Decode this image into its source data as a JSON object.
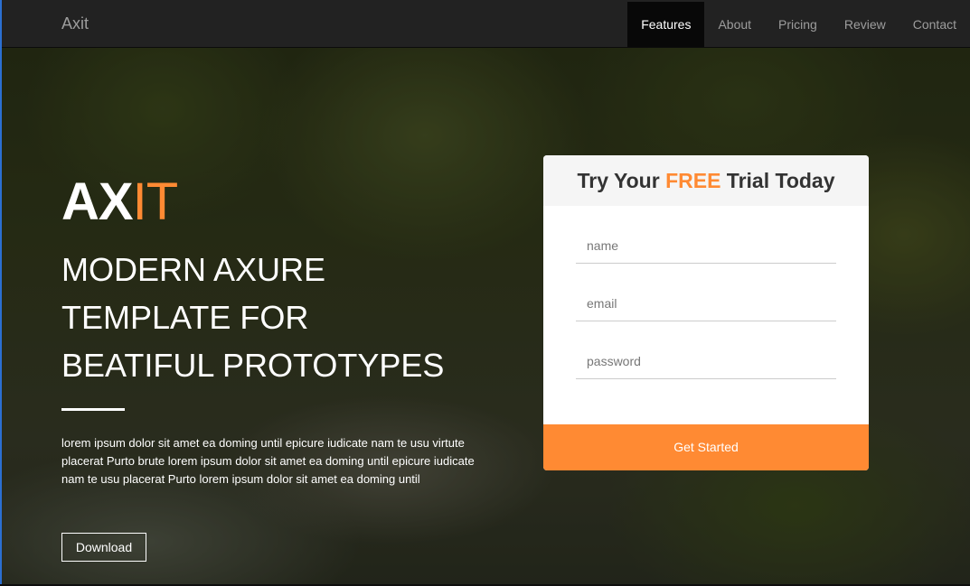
{
  "navbar": {
    "brand": "Axit",
    "items": [
      {
        "label": "Features",
        "active": true
      },
      {
        "label": "About",
        "active": false
      },
      {
        "label": "Pricing",
        "active": false
      },
      {
        "label": "Review",
        "active": false
      },
      {
        "label": "Contact",
        "active": false
      }
    ]
  },
  "hero": {
    "logo_white": "AX",
    "logo_orange": "IT",
    "headline_lines": [
      "MODERN AXURE",
      "TEMPLATE FOR",
      "BEATIFUL PROTOTYPES"
    ],
    "description": "lorem ipsum dolor sit amet ea doming until epicure iudicate nam te usu virtute placerat Purto brute lorem ipsum dolor sit amet ea doming until epicure iudicate nam te usu placerat Purto lorem ipsum dolor sit amet ea doming until",
    "download_label": "Download"
  },
  "trial": {
    "title_before": "Try Your ",
    "title_highlight": "FREE",
    "title_after": " Trial Today",
    "name_placeholder": "name",
    "email_placeholder": "email",
    "password_placeholder": "password",
    "submit_label": "Get Started"
  },
  "colors": {
    "accent": "#ff8a33",
    "navbar": "#222222",
    "nav_active": "#080808"
  }
}
